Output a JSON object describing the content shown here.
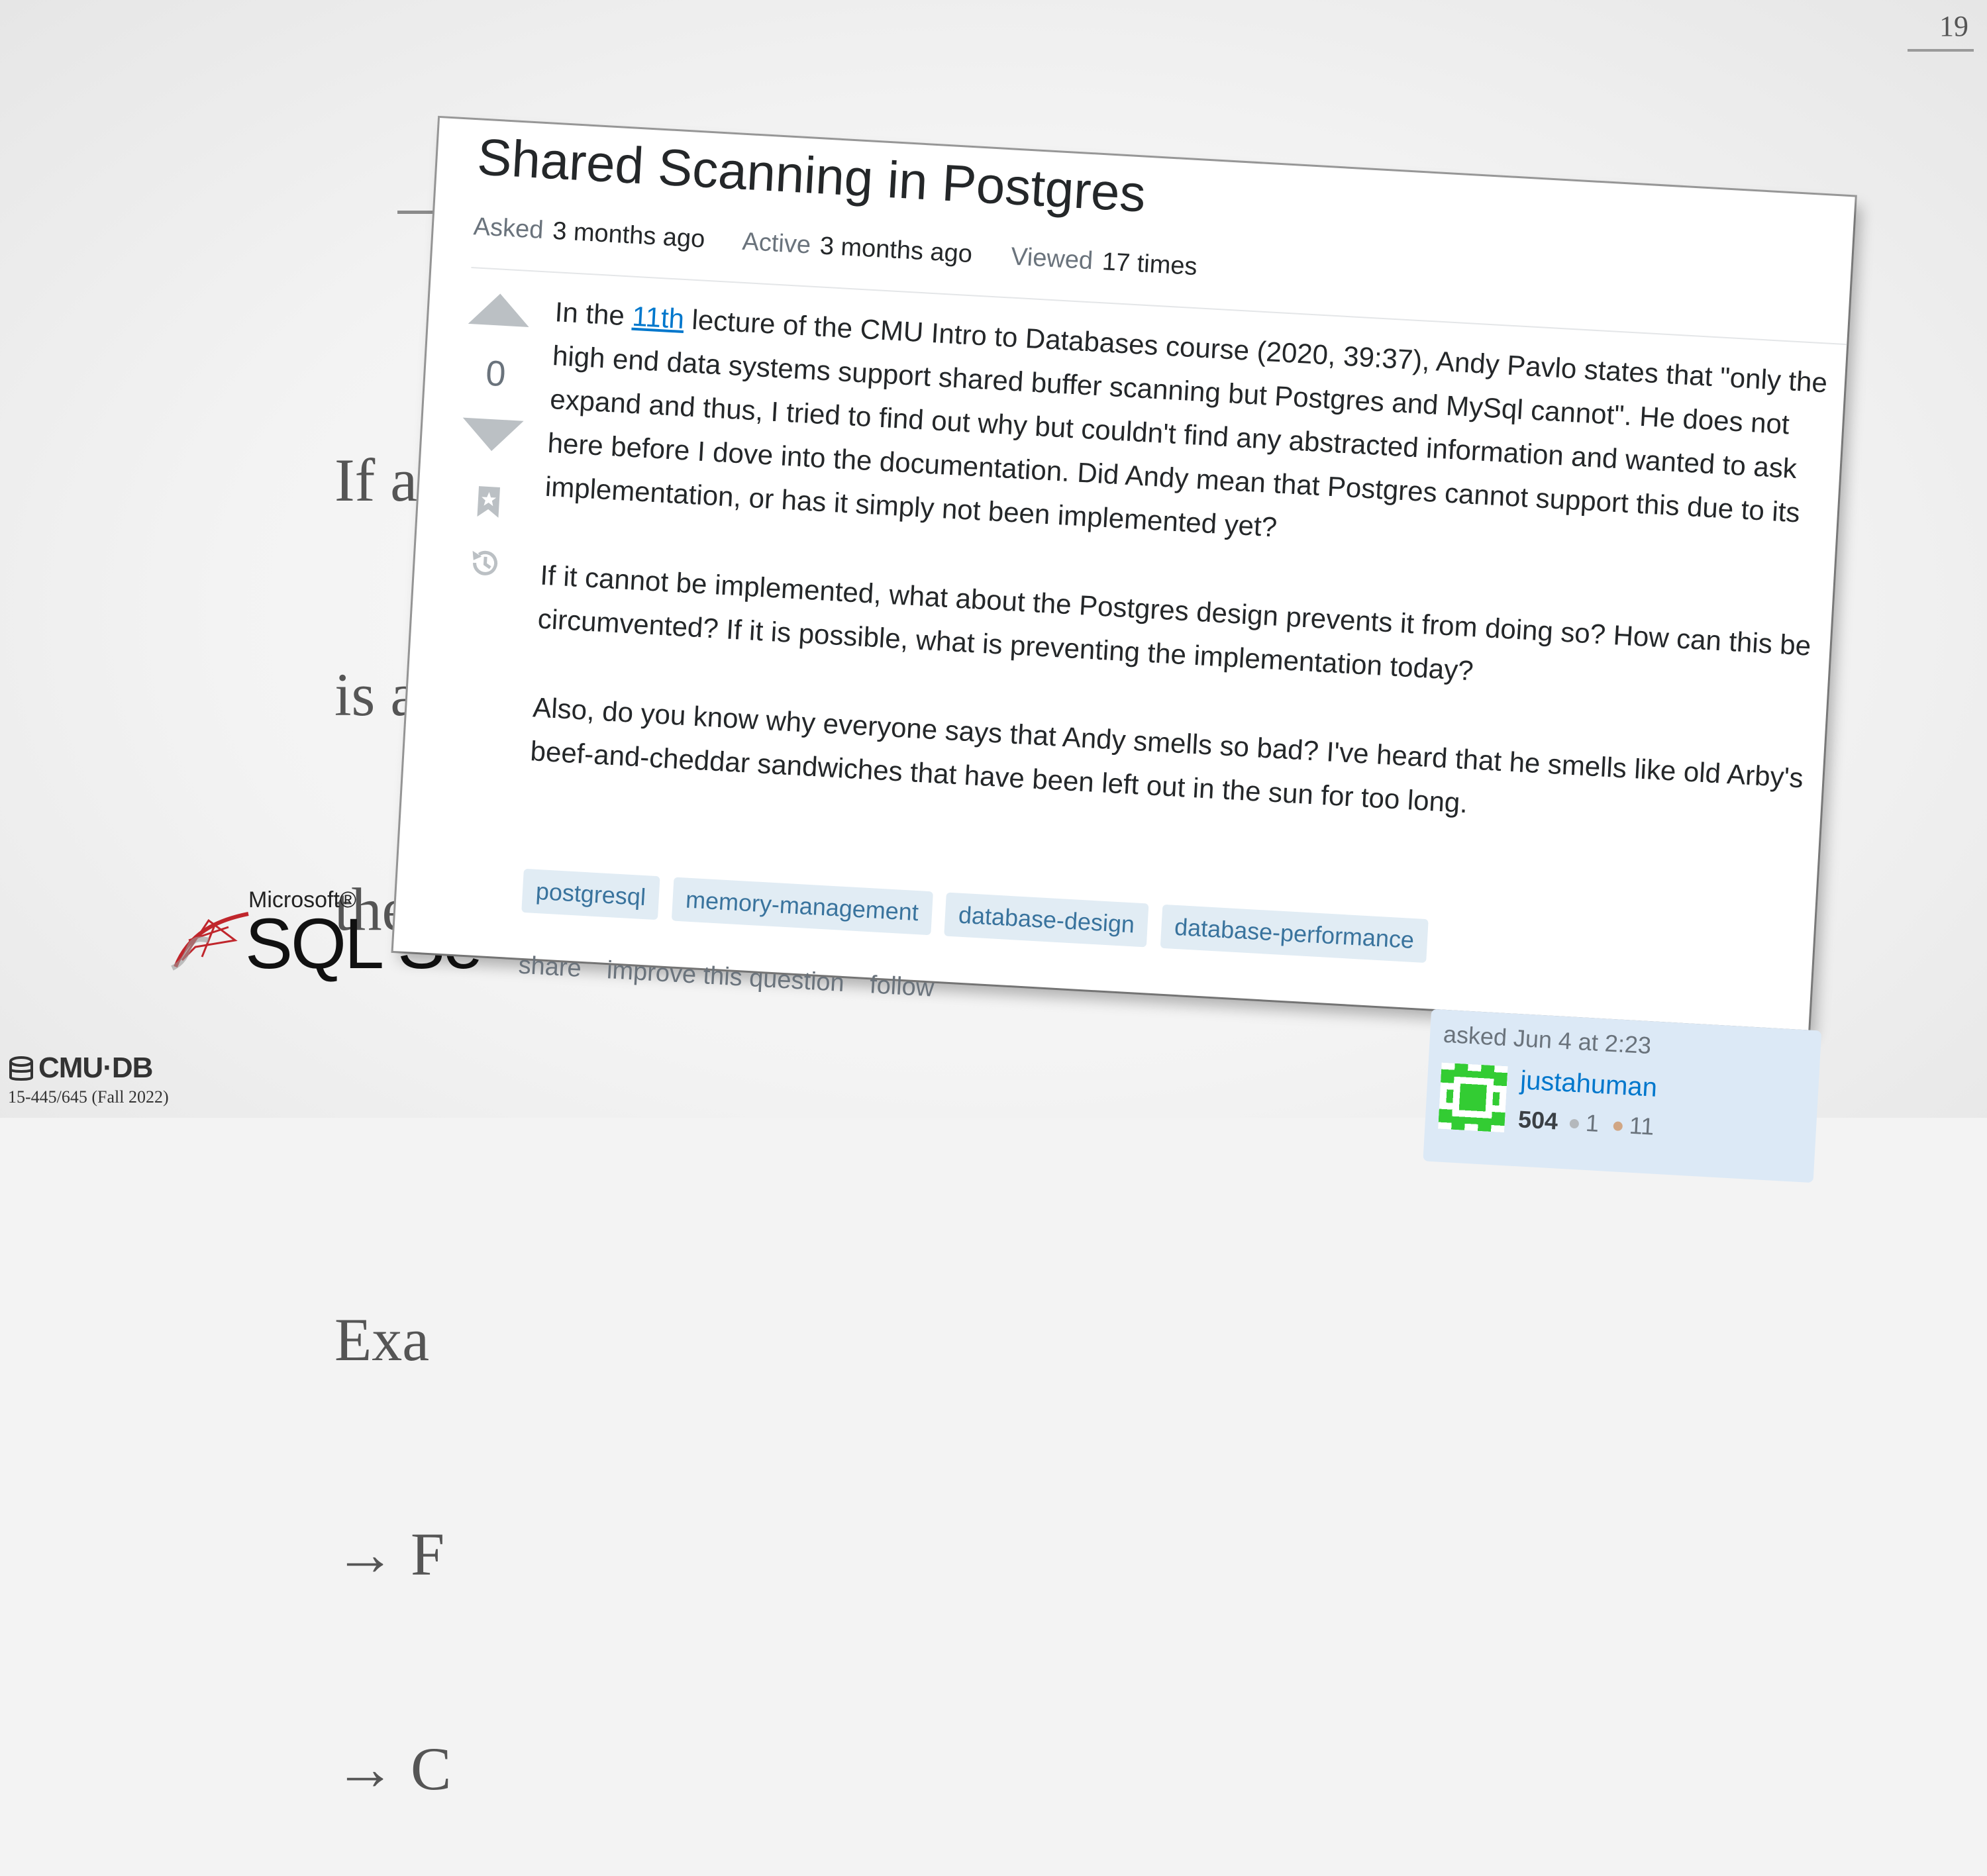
{
  "slide": {
    "page_number": "19",
    "visible_text_lines": [
      "If a q",
      "is alr",
      "the s",
      "",
      "Exa",
      "→ F",
      "→ C"
    ],
    "logo": {
      "microsoft": "Microsoft®",
      "sql": "SQL Se"
    },
    "footer": {
      "brand": "CMU·DB",
      "course": "15-445/645 (Fall 2022)"
    }
  },
  "question": {
    "title": "Shared Scanning in Postgres",
    "meta": [
      {
        "key": "Asked",
        "value": "3 months ago"
      },
      {
        "key": "Active",
        "value": "3 months ago"
      },
      {
        "key": "Viewed",
        "value": "17 times"
      }
    ],
    "votes": "0",
    "body": {
      "p1_before": "In the ",
      "p1_link": "11th",
      "p1_after": " lecture of the CMU Intro to Databases course (2020, 39:37), Andy Pavlo states that \"only the high end data systems support shared buffer scanning but Postgres and MySql cannot\". He does not expand and thus, I tried to find out why but couldn't find any abstracted information and wanted to ask here before I dove into the documentation. Did Andy mean that Postgres cannot support this due to its implementation, or has it simply not been implemented yet?",
      "p2": "If it cannot be implemented, what about the Postgres design prevents it from doing so? How can this be circumvented? If it is possible, what is preventing the implementation today?",
      "p3": "Also, do you know why everyone says that Andy smells so bad? I've heard that he smells like old Arby's beef-and-cheddar sandwiches that have been left out in the sun for too long."
    },
    "tags": [
      "postgresql",
      "memory-management",
      "database-design",
      "database-performance"
    ],
    "actions": {
      "share": "share",
      "improve": "improve this question",
      "follow": "follow"
    },
    "owner": {
      "asked": "asked Jun 4 at 2:23",
      "username": "justahuman",
      "reputation": "504",
      "silver": "1",
      "bronze": "11"
    }
  },
  "colors": {
    "link": "#0077cc",
    "tag_bg": "#e1ecf4",
    "tag_text": "#39739d",
    "owner_bg": "#dce9f6"
  }
}
